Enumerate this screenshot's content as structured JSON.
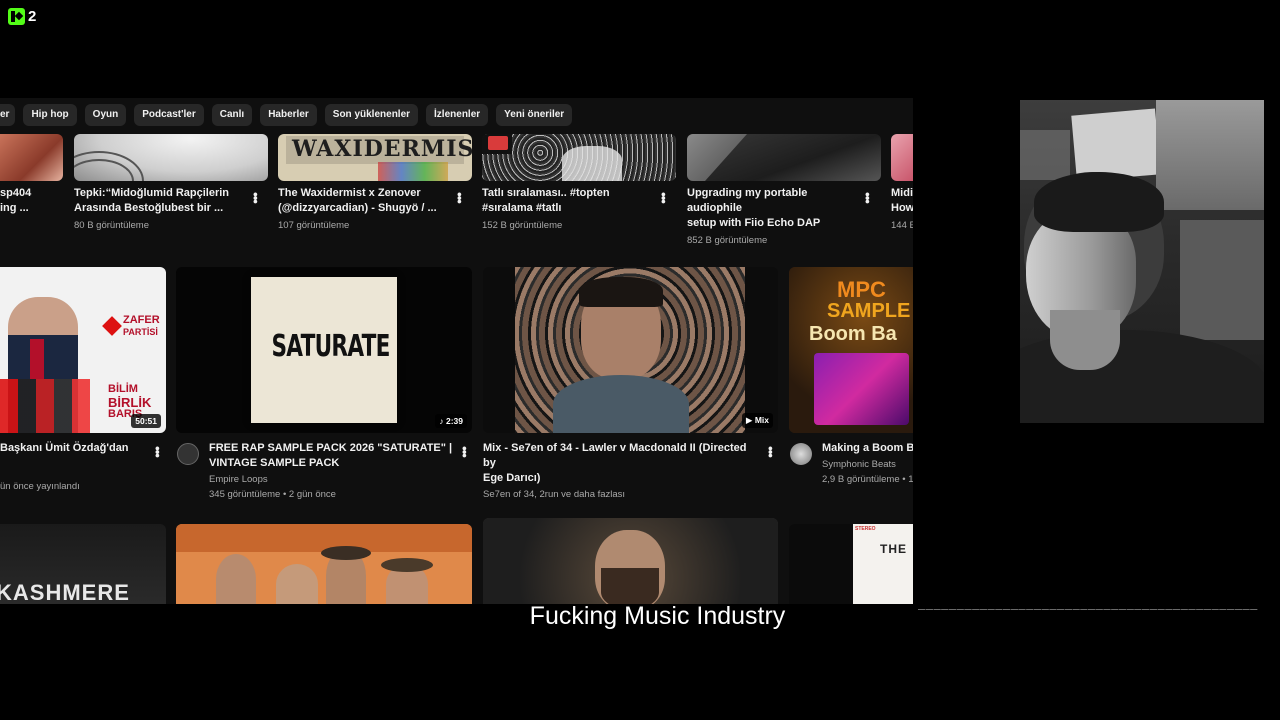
{
  "overlay": {
    "kick_number": "2",
    "subtitle": "Fucking Music Industry",
    "dash_line": "____________________________________________"
  },
  "chips": [
    "er",
    "Hip hop",
    "Oyun",
    "Podcast'ler",
    "Canlı",
    "Haberler",
    "Son yüklenenler",
    "İzlenenler",
    "Yeni öneriler"
  ],
  "row1": [
    {
      "title1": "sp404",
      "title2": "ing ...",
      "sub": ""
    },
    {
      "title1": "Tepki:“Midoğlumid Rapçilerin",
      "title2": "Arasında Bestoğlubest bir ...",
      "sub": "80 B görüntüleme"
    },
    {
      "title1": "The Waxidermist x Zenover",
      "title2": "(@dizzyarcadian) - Shugyö / ...",
      "sub": "107 görüntüleme",
      "thumb_text": "WAXIDERMIST"
    },
    {
      "title1": "Tatlı sıralaması.. #topten",
      "title2": "#sıralama #tatlı",
      "sub": "152 B görüntüleme"
    },
    {
      "title1": "Upgrading my portable audiophile",
      "title2": "setup with Fiio Echo DAP",
      "sub": "852 B görüntüleme"
    },
    {
      "title1": "Midi",
      "title2": "How",
      "sub": "144 E"
    }
  ],
  "row2": [
    {
      "title1": "Başkanı Ümit Özdağ'dan",
      "title2": "",
      "channel": "",
      "sub": "ün önce yayınlandı",
      "duration": "50:51",
      "banner": [
        "ZAFER",
        "PARTİSİ",
        "BİLİM",
        "BİRLİK",
        "BARIŞ"
      ]
    },
    {
      "title1": "FREE RAP SAMPLE PACK 2026 \"SATURATE\" |",
      "title2": "VINTAGE SAMPLE PACK",
      "channel": "Empire Loops",
      "sub": "345 görüntüleme • 2 gün önce",
      "duration": "♪ 2:39",
      "thumb_text": "SATURATE"
    },
    {
      "title1": "Mix - Se7en of 34 - Lawler v Macdonald II (Directed by",
      "title2": "Ege Darıcı)",
      "channel": "",
      "sub": "Se7en of 34, 2run ve daha fazlası",
      "duration": "▶ Mix"
    },
    {
      "title1": "Making a Boom Ba",
      "title2": "",
      "channel": "Symphonic Beats",
      "sub": "2,9 B görüntüleme • 1",
      "thumb_text1": "MPC",
      "thumb_text2": "SAMPLE",
      "thumb_text3": "Boom Ba"
    }
  ],
  "row3": [
    {
      "thumb_text": "KASHMERE"
    },
    {
      "thumb_text": ""
    },
    {
      "thumb_text": ""
    },
    {
      "thumb_text": "THE",
      "stereo": "STEREO"
    }
  ],
  "colors": {
    "kick_green": "#53fc18",
    "yt_bg": "#0f0f0f",
    "chip_bg": "#272727"
  }
}
